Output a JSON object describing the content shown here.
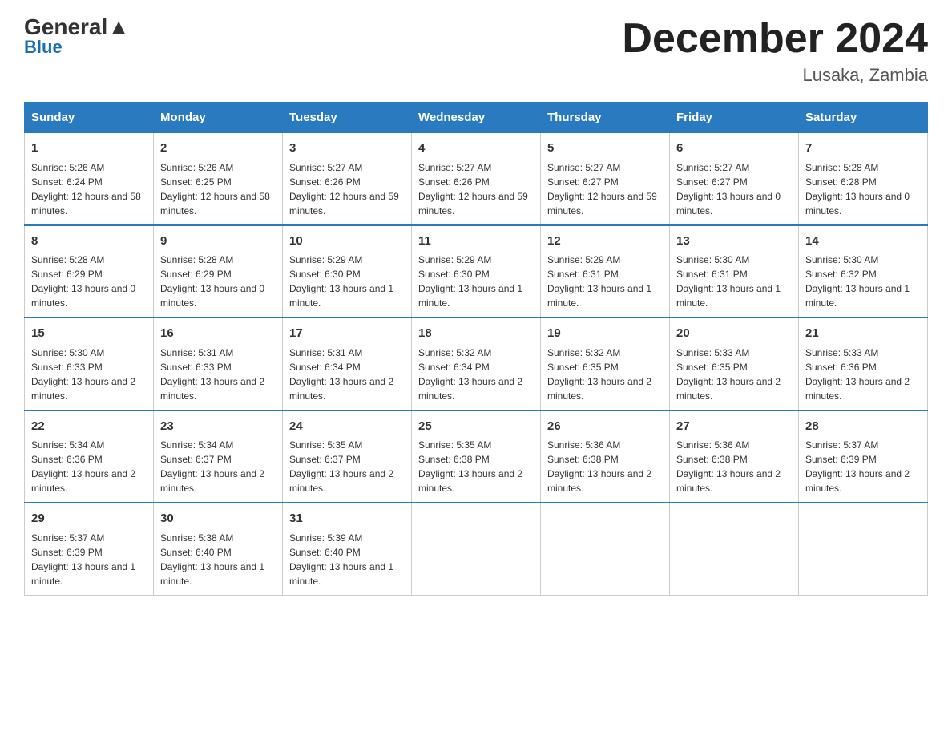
{
  "header": {
    "logo_general": "General",
    "logo_blue": "Blue",
    "month_title": "December 2024",
    "location": "Lusaka, Zambia"
  },
  "weekdays": [
    "Sunday",
    "Monday",
    "Tuesday",
    "Wednesday",
    "Thursday",
    "Friday",
    "Saturday"
  ],
  "weeks": [
    [
      {
        "day": "1",
        "sunrise": "Sunrise: 5:26 AM",
        "sunset": "Sunset: 6:24 PM",
        "daylight": "Daylight: 12 hours and 58 minutes."
      },
      {
        "day": "2",
        "sunrise": "Sunrise: 5:26 AM",
        "sunset": "Sunset: 6:25 PM",
        "daylight": "Daylight: 12 hours and 58 minutes."
      },
      {
        "day": "3",
        "sunrise": "Sunrise: 5:27 AM",
        "sunset": "Sunset: 6:26 PM",
        "daylight": "Daylight: 12 hours and 59 minutes."
      },
      {
        "day": "4",
        "sunrise": "Sunrise: 5:27 AM",
        "sunset": "Sunset: 6:26 PM",
        "daylight": "Daylight: 12 hours and 59 minutes."
      },
      {
        "day": "5",
        "sunrise": "Sunrise: 5:27 AM",
        "sunset": "Sunset: 6:27 PM",
        "daylight": "Daylight: 12 hours and 59 minutes."
      },
      {
        "day": "6",
        "sunrise": "Sunrise: 5:27 AM",
        "sunset": "Sunset: 6:27 PM",
        "daylight": "Daylight: 13 hours and 0 minutes."
      },
      {
        "day": "7",
        "sunrise": "Sunrise: 5:28 AM",
        "sunset": "Sunset: 6:28 PM",
        "daylight": "Daylight: 13 hours and 0 minutes."
      }
    ],
    [
      {
        "day": "8",
        "sunrise": "Sunrise: 5:28 AM",
        "sunset": "Sunset: 6:29 PM",
        "daylight": "Daylight: 13 hours and 0 minutes."
      },
      {
        "day": "9",
        "sunrise": "Sunrise: 5:28 AM",
        "sunset": "Sunset: 6:29 PM",
        "daylight": "Daylight: 13 hours and 0 minutes."
      },
      {
        "day": "10",
        "sunrise": "Sunrise: 5:29 AM",
        "sunset": "Sunset: 6:30 PM",
        "daylight": "Daylight: 13 hours and 1 minute."
      },
      {
        "day": "11",
        "sunrise": "Sunrise: 5:29 AM",
        "sunset": "Sunset: 6:30 PM",
        "daylight": "Daylight: 13 hours and 1 minute."
      },
      {
        "day": "12",
        "sunrise": "Sunrise: 5:29 AM",
        "sunset": "Sunset: 6:31 PM",
        "daylight": "Daylight: 13 hours and 1 minute."
      },
      {
        "day": "13",
        "sunrise": "Sunrise: 5:30 AM",
        "sunset": "Sunset: 6:31 PM",
        "daylight": "Daylight: 13 hours and 1 minute."
      },
      {
        "day": "14",
        "sunrise": "Sunrise: 5:30 AM",
        "sunset": "Sunset: 6:32 PM",
        "daylight": "Daylight: 13 hours and 1 minute."
      }
    ],
    [
      {
        "day": "15",
        "sunrise": "Sunrise: 5:30 AM",
        "sunset": "Sunset: 6:33 PM",
        "daylight": "Daylight: 13 hours and 2 minutes."
      },
      {
        "day": "16",
        "sunrise": "Sunrise: 5:31 AM",
        "sunset": "Sunset: 6:33 PM",
        "daylight": "Daylight: 13 hours and 2 minutes."
      },
      {
        "day": "17",
        "sunrise": "Sunrise: 5:31 AM",
        "sunset": "Sunset: 6:34 PM",
        "daylight": "Daylight: 13 hours and 2 minutes."
      },
      {
        "day": "18",
        "sunrise": "Sunrise: 5:32 AM",
        "sunset": "Sunset: 6:34 PM",
        "daylight": "Daylight: 13 hours and 2 minutes."
      },
      {
        "day": "19",
        "sunrise": "Sunrise: 5:32 AM",
        "sunset": "Sunset: 6:35 PM",
        "daylight": "Daylight: 13 hours and 2 minutes."
      },
      {
        "day": "20",
        "sunrise": "Sunrise: 5:33 AM",
        "sunset": "Sunset: 6:35 PM",
        "daylight": "Daylight: 13 hours and 2 minutes."
      },
      {
        "day": "21",
        "sunrise": "Sunrise: 5:33 AM",
        "sunset": "Sunset: 6:36 PM",
        "daylight": "Daylight: 13 hours and 2 minutes."
      }
    ],
    [
      {
        "day": "22",
        "sunrise": "Sunrise: 5:34 AM",
        "sunset": "Sunset: 6:36 PM",
        "daylight": "Daylight: 13 hours and 2 minutes."
      },
      {
        "day": "23",
        "sunrise": "Sunrise: 5:34 AM",
        "sunset": "Sunset: 6:37 PM",
        "daylight": "Daylight: 13 hours and 2 minutes."
      },
      {
        "day": "24",
        "sunrise": "Sunrise: 5:35 AM",
        "sunset": "Sunset: 6:37 PM",
        "daylight": "Daylight: 13 hours and 2 minutes."
      },
      {
        "day": "25",
        "sunrise": "Sunrise: 5:35 AM",
        "sunset": "Sunset: 6:38 PM",
        "daylight": "Daylight: 13 hours and 2 minutes."
      },
      {
        "day": "26",
        "sunrise": "Sunrise: 5:36 AM",
        "sunset": "Sunset: 6:38 PM",
        "daylight": "Daylight: 13 hours and 2 minutes."
      },
      {
        "day": "27",
        "sunrise": "Sunrise: 5:36 AM",
        "sunset": "Sunset: 6:38 PM",
        "daylight": "Daylight: 13 hours and 2 minutes."
      },
      {
        "day": "28",
        "sunrise": "Sunrise: 5:37 AM",
        "sunset": "Sunset: 6:39 PM",
        "daylight": "Daylight: 13 hours and 2 minutes."
      }
    ],
    [
      {
        "day": "29",
        "sunrise": "Sunrise: 5:37 AM",
        "sunset": "Sunset: 6:39 PM",
        "daylight": "Daylight: 13 hours and 1 minute."
      },
      {
        "day": "30",
        "sunrise": "Sunrise: 5:38 AM",
        "sunset": "Sunset: 6:40 PM",
        "daylight": "Daylight: 13 hours and 1 minute."
      },
      {
        "day": "31",
        "sunrise": "Sunrise: 5:39 AM",
        "sunset": "Sunset: 6:40 PM",
        "daylight": "Daylight: 13 hours and 1 minute."
      },
      null,
      null,
      null,
      null
    ]
  ]
}
